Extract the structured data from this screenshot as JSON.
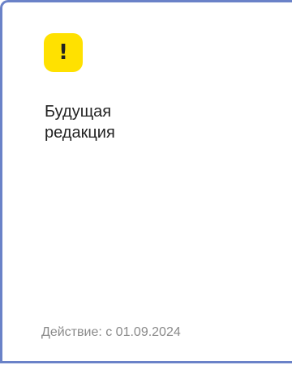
{
  "card": {
    "badge_icon": "!",
    "title_lines": [
      "Будущая",
      "редакция"
    ],
    "effective_text": "Действие: с 01.09.2024",
    "colors": {
      "border": "#6a82c8",
      "badge": "#ffe100",
      "title": "#222222",
      "effective": "#8a8a8a"
    }
  }
}
